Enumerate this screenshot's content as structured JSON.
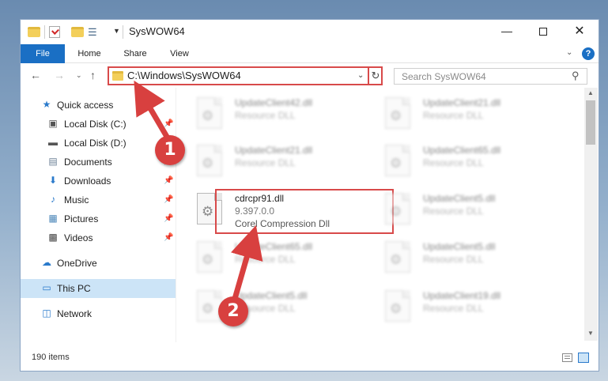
{
  "window": {
    "title": "SysWOW64",
    "controls": {
      "minimize": "—",
      "maximize": "",
      "close": "✕"
    }
  },
  "ribbon": {
    "tabs": [
      "File",
      "Home",
      "Share",
      "View"
    ],
    "help": "?"
  },
  "navigation": {
    "address": "C:\\Windows\\SysWOW64",
    "search_placeholder": "Search SysWOW64"
  },
  "sidebar": {
    "items": [
      {
        "label": "Quick access",
        "icon": "star-icon",
        "pinned": false
      },
      {
        "label": "Local Disk (C:)",
        "icon": "drive-icon",
        "pinned": true
      },
      {
        "label": "Local Disk (D:)",
        "icon": "drive-icon",
        "pinned": true
      },
      {
        "label": "Documents",
        "icon": "documents-icon",
        "pinned": true
      },
      {
        "label": "Downloads",
        "icon": "download-icon",
        "pinned": true
      },
      {
        "label": "Music",
        "icon": "music-icon",
        "pinned": true
      },
      {
        "label": "Pictures",
        "icon": "pictures-icon",
        "pinned": true
      },
      {
        "label": "Videos",
        "icon": "videos-icon",
        "pinned": true
      },
      {
        "label": "OneDrive",
        "icon": "cloud-icon",
        "pinned": false
      },
      {
        "label": "This PC",
        "icon": "computer-icon",
        "pinned": false,
        "selected": true
      },
      {
        "label": "Network",
        "icon": "network-icon",
        "pinned": false
      }
    ]
  },
  "files": [
    {
      "name": "UpdateClient42.dll",
      "type": "Resource DLL",
      "extra": "",
      "blurred": true
    },
    {
      "name": "UpdateClient21.dll",
      "type": "Resource DLL",
      "extra": "",
      "blurred": true
    },
    {
      "name": "UpdateClient21.dll",
      "type": "Resource DLL",
      "extra": "",
      "blurred": true
    },
    {
      "name": "UpdateClient65.dll",
      "type": "Resource DLL",
      "extra": "",
      "blurred": true
    },
    {
      "name": "cdrcpr91.dll",
      "type": "9.397.0.0",
      "extra": "Corel Compression Dll",
      "blurred": false
    },
    {
      "name": "UpdateClient5.dll",
      "type": "Resource DLL",
      "extra": "",
      "blurred": true
    },
    {
      "name": "UpdateClient65.dll",
      "type": "Resource DLL",
      "extra": "",
      "blurred": true
    },
    {
      "name": "UpdateClient5.dll",
      "type": "Resource DLL",
      "extra": "",
      "blurred": true
    },
    {
      "name": "UpdateClient5.dll",
      "type": "Resource DLL",
      "extra": "",
      "blurred": true
    },
    {
      "name": "UpdateClient19.dll",
      "type": "Resource DLL",
      "extra": "",
      "blurred": true
    }
  ],
  "status": {
    "item_count": "190 items"
  },
  "callouts": [
    "1",
    "2"
  ],
  "colors": {
    "accent": "#1a6fc4",
    "highlight": "#d84a4a",
    "callout": "#d8403f",
    "selection": "#cce4f7"
  }
}
